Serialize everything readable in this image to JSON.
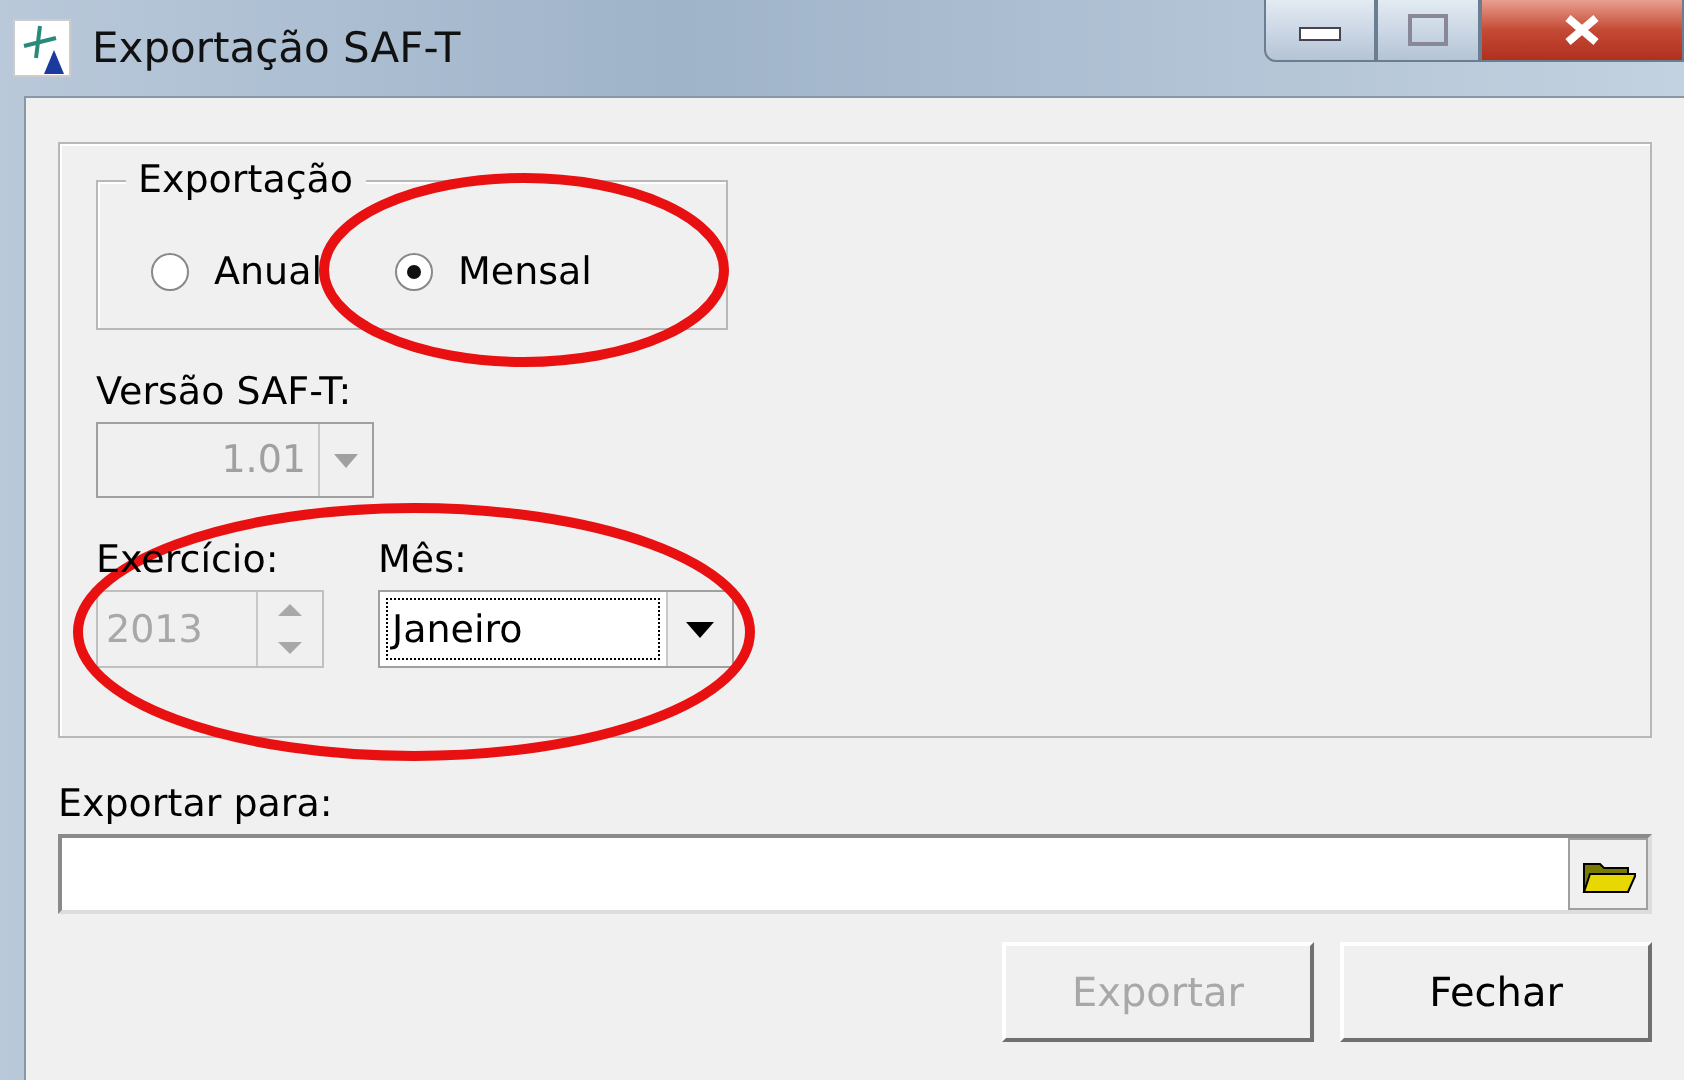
{
  "window": {
    "title": "Exportação SAF-T"
  },
  "export_group": {
    "title": "Exportação",
    "options": [
      {
        "label": "Anual",
        "selected": false
      },
      {
        "label": "Mensal",
        "selected": true
      }
    ]
  },
  "version": {
    "label": "Versão SAF-T:",
    "value": "1.01",
    "disabled": true
  },
  "year": {
    "label": "Exercício:",
    "value": "2013",
    "disabled": true
  },
  "month": {
    "label": "Mês:",
    "value": "Janeiro",
    "focused": true
  },
  "export_to": {
    "label": "Exportar para:"
  },
  "buttons": [
    {
      "label": "Exportar",
      "disabled": true
    },
    {
      "label": "Fechar",
      "disabled": false
    }
  ],
  "highlights": [
    {
      "kind": "ellipse"
    },
    {
      "kind": "ellipse"
    }
  ]
}
